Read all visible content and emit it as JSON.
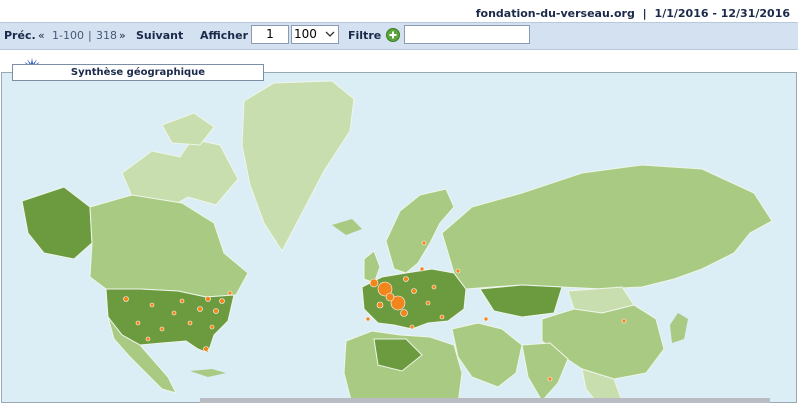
{
  "header": {
    "site": "fondation-du-verseau.org",
    "separator": "|",
    "date_range": "1/1/2016 - 12/31/2016"
  },
  "toolbar": {
    "prev_label": "Préc.",
    "range_label": "1-100",
    "total_label": "318",
    "next_label": "Suivant",
    "show_label": "Afficher",
    "page_value": "1",
    "per_page_value": "100",
    "filter_label": "Filtre",
    "filter_value": ""
  },
  "panel": {
    "title": "Synthèse géographique"
  },
  "colors": {
    "toolbar_bg": "#d3e1f0",
    "ocean": "#dbedf5",
    "land_light": "#c9deae",
    "land_mid": "#a9ca82",
    "land_dark": "#6c9b3f",
    "marker": "#f2851c"
  }
}
